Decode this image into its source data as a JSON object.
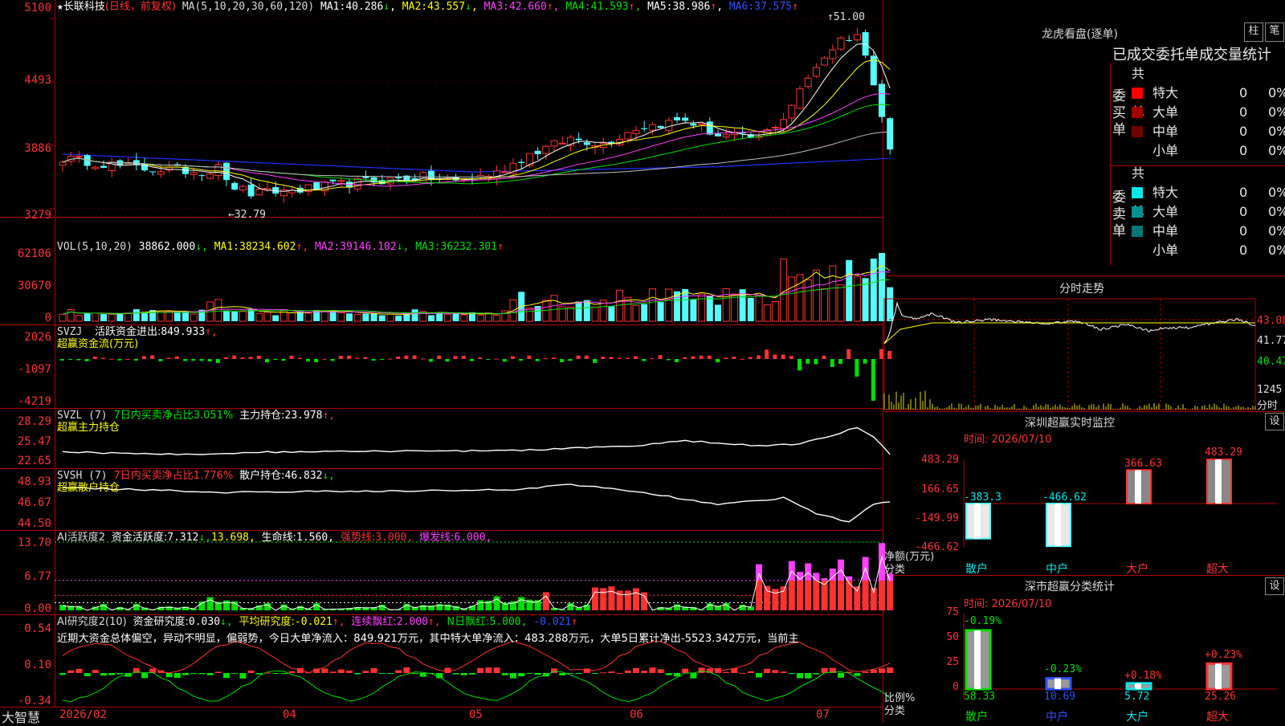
{
  "stock": {
    "name_prefix": "★",
    "name": "长联科技",
    "period": "(日线，前复权)"
  },
  "colors": {
    "up": "#ff3232",
    "down": "#54fcfc",
    "ma1": "#ffffff",
    "ma2": "#ffff00",
    "ma3": "#ff40ff",
    "ma4": "#00e000",
    "ma5": "#c0c0c0",
    "ma6": "#2030ff"
  },
  "price_panel": {
    "ma_label": "MA(5,10,20,30,60,120)",
    "ma": [
      {
        "label": "MA1:",
        "value": "40.286",
        "arrow": "↓",
        "color": "#ffffff"
      },
      {
        "label": "MA2:",
        "value": "43.557",
        "arrow": "↓",
        "color": "#ffff00"
      },
      {
        "label": "MA3:",
        "value": "42.660",
        "arrow": "↑",
        "color": "#ff40ff"
      },
      {
        "label": "MA4:",
        "value": "41.593",
        "arrow": "↑",
        "color": "#00e000"
      },
      {
        "label": "MA5:",
        "value": "38.986",
        "arrow": "↑",
        "color": "#c0c0c0"
      },
      {
        "label": "MA6:",
        "value": "37.575",
        "arrow": "↑",
        "color": "#2030ff"
      }
    ],
    "y_ticks": [
      "5100",
      "4493",
      "3886",
      "3279"
    ],
    "high_label": "51.00",
    "low_label": "32.79"
  },
  "vol_panel": {
    "label": "VOL(5,10,20)",
    "value": "38862.000",
    "value_arrow": "↓,",
    "ma": [
      {
        "label": "MA1:",
        "value": "38234.602",
        "arrow": "↑,",
        "color": "#ffff00"
      },
      {
        "label": "MA2:",
        "value": "39146.102",
        "arrow": "↓,",
        "color": "#ff40ff"
      },
      {
        "label": "MA3:",
        "value": "36232.301",
        "arrow": "↑",
        "color": "#00e000"
      }
    ],
    "y_ticks": [
      "62106",
      "30670",
      "0"
    ]
  },
  "svzj_panel": {
    "label": "SVZJ",
    "item": "活跃资金进出:",
    "value": "849.933",
    "arrow": "↑,",
    "sub": "超赢资金流(万元)",
    "y_ticks": [
      "2026",
      "-1097",
      "-4219"
    ]
  },
  "svzl_panel": {
    "label": "SVZL (7)",
    "item1": "7日内买卖净占比3.051%",
    "item2": "主力持仓:",
    "value": "23.978",
    "arrow": "↑,",
    "sub": "超赢主力持仓",
    "y_ticks": [
      "28.29",
      "25.47",
      "22.65"
    ]
  },
  "svsh_panel": {
    "label": "SVSH (7)",
    "item1": "7日内买卖净占比1.776%",
    "item2": "散户持仓:",
    "value": "46.832",
    "arrow": "↓,",
    "sub": "超赢散户持仓",
    "y_ticks": [
      "48.93",
      "46.67",
      "44.50"
    ]
  },
  "ai_panel": {
    "label": "AI活跃度2",
    "item1": "资金活跃度:",
    "v1": "7.312",
    "a1": "↓,",
    "v2": "13.698,",
    "item3": "生命线:",
    "v3": "1.560,",
    "item4": "强势线:",
    "v4": "3.000,",
    "item5": "爆发线:",
    "v5": "6.000,",
    "y_ticks": [
      "13.70",
      "6.77",
      "0.00"
    ]
  },
  "research_panel": {
    "label": "AI研究度2(10)",
    "item1": "资金研究度:",
    "v1": "0.030",
    "a1": "↓,",
    "item2": "平均研究度:",
    "v2": "-0.021",
    "a2": "↑,",
    "item3": "连续飘红:",
    "v3": "2.000",
    "a3": "↑,",
    "item4": "N日飘红:",
    "v4": "5.000,",
    "v5": "-0.021",
    "a5": "↑",
    "comment": "近期大资金总体偏空，异动不明显，偏弱势，今日大单净流入：849.921万元，其中特大单净流入：483.288万元，大单5日累计净出-5523.342万元，当前主",
    "y_ticks": [
      "0.54",
      "0.10",
      "-0.34"
    ]
  },
  "x_axis": {
    "brand": "大智慧",
    "labels": [
      "2026/02",
      "04",
      "05",
      "06",
      "07"
    ]
  },
  "dragon_tiger": {
    "title": "龙虎看盘(逐单)",
    "btn_bar": "柱",
    "btn_tick": "笔",
    "subtitle": "已成交委托单成交量统计",
    "buy_label": "委买单",
    "sell_label": "委卖单",
    "buy_total": "共 0单",
    "sell_total": "共 0单",
    "buy_rows": [
      {
        "name": "特大",
        "count": "0",
        "pct": "0%",
        "color": "#ff0000"
      },
      {
        "name": "大单",
        "count": "0",
        "pct": "0%",
        "color": "#a00000"
      },
      {
        "name": "中单",
        "count": "0",
        "pct": "0%",
        "color": "#700000"
      },
      {
        "name": "小单",
        "count": "0",
        "pct": "0%",
        "color": ""
      }
    ],
    "sell_rows": [
      {
        "name": "特大",
        "count": "0",
        "pct": "0%",
        "color": "#00e8e8"
      },
      {
        "name": "大单",
        "count": "0",
        "pct": "0%",
        "color": "#009090"
      },
      {
        "name": "中单",
        "count": "0",
        "pct": "0%",
        "color": "#007878"
      },
      {
        "name": "小单",
        "count": "0",
        "pct": "0%",
        "color": ""
      }
    ]
  },
  "intraday": {
    "title": "分时走势",
    "y_ticks": [
      "43.08",
      "41.77",
      "40.47"
    ],
    "vol_tick": "1245",
    "vol_label": "分时"
  },
  "sz_monitor": {
    "title": "深圳超赢实时监控",
    "settings": "设",
    "date": "时间: 2026/07/10",
    "y_ticks": [
      "483.29",
      "166.65",
      "-149.99",
      "-466.62"
    ],
    "y_label": "净额(万元)",
    "x_label": "分类",
    "categories": [
      "散户",
      "中户",
      "大户",
      "超大"
    ],
    "value_labels": [
      "-383.3",
      "-466.62",
      "366.63",
      "483.29"
    ]
  },
  "sz_class": {
    "title": "深市超赢分类统计",
    "settings": "设",
    "date": "时间: 2026/07/10",
    "y_ticks": [
      "75",
      "50",
      "25",
      "0"
    ],
    "y_label": "比例%",
    "x_label": "分类",
    "categories": [
      "散户",
      "中户",
      "大户",
      "超大"
    ],
    "change_labels": [
      "-0.19%",
      "-0.23%",
      "+0.18%",
      "+0.23%"
    ],
    "value_labels": [
      "58.33",
      "10.69",
      "5.72",
      "25.26"
    ]
  },
  "chart_data": [
    {
      "type": "candlestick",
      "title": "长联科技(日线，前复权)",
      "ylim": [
        32.0,
        52.0
      ],
      "high": 51.0,
      "low": 32.79,
      "last_ma": {
        "MA5": 40.286,
        "MA10": 43.557,
        "MA20": 42.66,
        "MA30": 41.593,
        "MA60": 38.986,
        "MA120": 37.575
      },
      "y_ticks": [
        51.0,
        44.93,
        38.86,
        32.79
      ]
    },
    {
      "type": "bar",
      "title": "VOL(5,10,20)",
      "last": 38862.0,
      "ma": {
        "MA1": 38234.602,
        "MA2": 39146.102,
        "MA3": 36232.301
      },
      "ylim": [
        0,
        62106
      ]
    },
    {
      "type": "bar",
      "title": "深圳超赢实时监控",
      "categories": [
        "散户",
        "中户",
        "大户",
        "超大"
      ],
      "values": [
        -383.3,
        -466.62,
        366.63,
        483.29
      ],
      "ylabel": "净额(万元)",
      "ylim": [
        -466.62,
        483.29
      ]
    },
    {
      "type": "bar",
      "title": "深市超赢分类统计",
      "categories": [
        "散户",
        "中户",
        "大户",
        "超大"
      ],
      "values": [
        58.33,
        10.69,
        5.72,
        25.26
      ],
      "changes": [
        -0.19,
        -0.23,
        0.18,
        0.23
      ],
      "ylabel": "比例%",
      "ylim": [
        0,
        75
      ]
    }
  ]
}
